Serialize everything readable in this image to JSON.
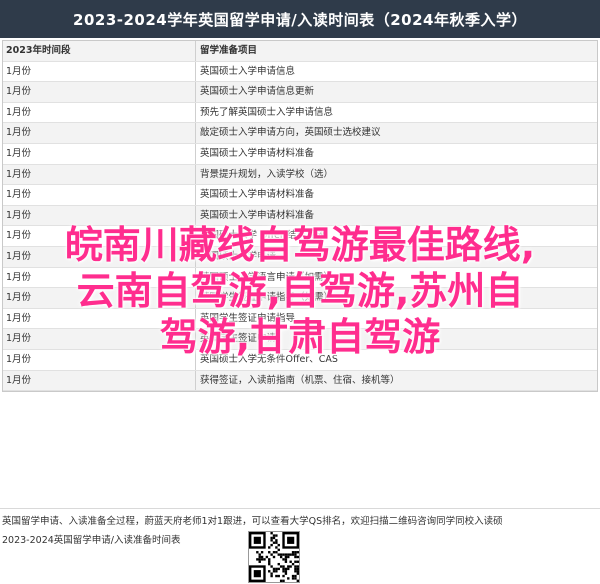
{
  "document": {
    "title": "2023-2024学年英国留学申请/入读时间表（2024年秋季入学）",
    "table": {
      "headers": {
        "time": "2023年时间段",
        "items": "留学准备项目"
      },
      "rows": [
        {
          "time": "1月份",
          "items": "英国硕士入学申请信息"
        },
        {
          "time": "1月份",
          "items": "英国硕士入学申请信息更新"
        },
        {
          "time": "1月份",
          "items": "预先了解英国硕士入学申请信息"
        },
        {
          "time": "1月份",
          "items": "敲定硕士入学申请方向，英国硕士选校建议"
        },
        {
          "time": "1月份",
          "items": "英国硕士入学申请材料准备"
        },
        {
          "time": "1月份",
          "items": "背景提升规划，入读学校（选）"
        },
        {
          "time": "1月份",
          "items": "英国硕士入学申请材料准备"
        },
        {
          "time": "1月份",
          "items": "英国硕士入学申请材料准备"
        },
        {
          "time": "1月份",
          "items": "英国硕士入学 Offer 结果发放"
        },
        {
          "time": "1月份",
          "items": "英国硕士入学申请"
        },
        {
          "time": "1月份",
          "items": "英国硕士入学语言申请（如需）"
        },
        {
          "time": "1月份",
          "items": "英国学生签证申请指导（如需）"
        },
        {
          "time": "1月份",
          "items": "英国学生签证申请指导"
        },
        {
          "time": "1月份",
          "items": "英国学生签证申请"
        },
        {
          "time": "1月份",
          "items": "英国硕士入学无条件Offer、CAS"
        },
        {
          "time": "1月份",
          "items": "获得签证，入读前指南（机票、住宿、接机等）"
        }
      ]
    },
    "footer": {
      "notice": "英国留学申请、入读准备全过程，蔚蓝天府老师1对1跟进，可以查看大学QS排名，欢迎扫描二维码咨询同学同校入读硕士",
      "caption": "2023-2024英国留学申请/入读准备时间表"
    }
  },
  "overlay": {
    "line1": "皖南川藏线自驾游最佳路线,",
    "line2": "云南自驾游,自驾游,苏州自",
    "line3": "驾游,甘肃自驾游",
    "color": "#ff2d8e"
  },
  "colors": {
    "title_bg": "#2f3b4a",
    "title_text": "#ffffff",
    "row_alt": "#f3f3f3"
  }
}
